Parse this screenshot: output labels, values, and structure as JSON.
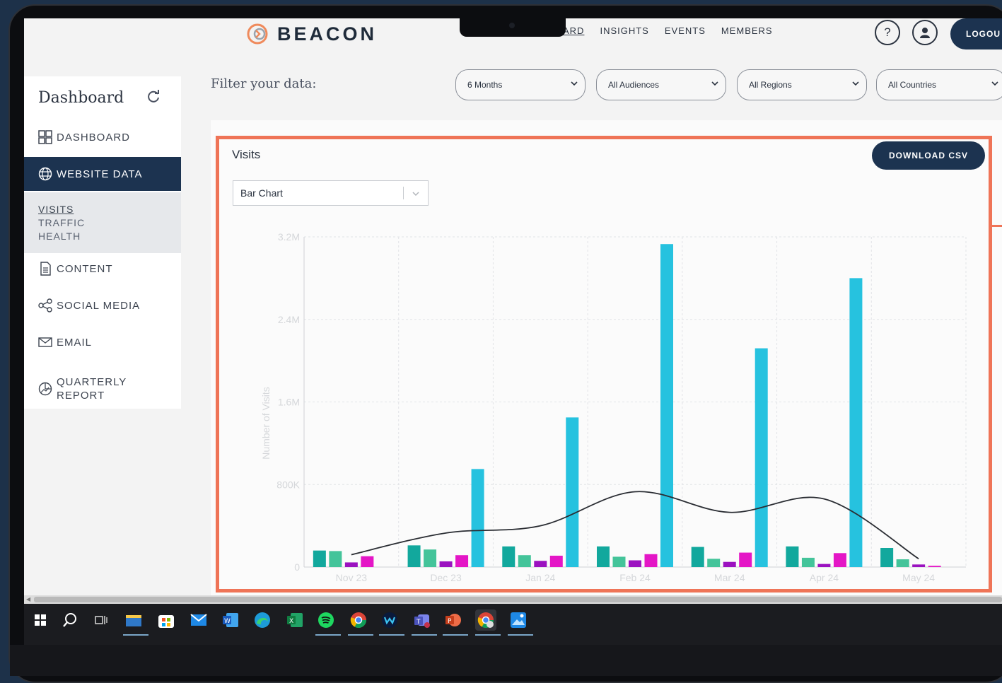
{
  "app": {
    "brand": "BEACON",
    "logout_label": "LOGOU"
  },
  "topnav": [
    {
      "label": "ARD",
      "active": true
    },
    {
      "label": "INSIGHTS"
    },
    {
      "label": "EVENTS"
    },
    {
      "label": "MEMBERS"
    }
  ],
  "header_icons": {
    "help": "?",
    "user": "user-icon"
  },
  "sidebar": {
    "title": "Dashboard",
    "items": [
      {
        "label": "DASHBOARD",
        "icon": "grid-icon"
      },
      {
        "label": "WEBSITE DATA",
        "icon": "globe-icon",
        "active": true
      },
      {
        "label": "CONTENT",
        "icon": "document-icon"
      },
      {
        "label": "SOCIAL MEDIA",
        "icon": "share-icon"
      },
      {
        "label": "EMAIL",
        "icon": "envelope-icon"
      },
      {
        "label": "QUARTERLY\nREPORT",
        "icon": "chart-globe-icon"
      }
    ],
    "subitems": [
      {
        "label": "VISITS",
        "active": true
      },
      {
        "label": "TRAFFIC"
      },
      {
        "label": "HEALTH"
      }
    ]
  },
  "filters": {
    "label": "Filter your data:",
    "period": "6 Months",
    "audience": "All Audiences",
    "region": "All Regions",
    "country": "All Countries"
  },
  "panel": {
    "title": "Visits",
    "download_label": "DOWNLOAD CSV",
    "chart_type_select": "Bar Chart"
  },
  "colors": {
    "navy": "#1c3350",
    "highlight": "#ef7457",
    "series": [
      "#12a89d",
      "#44c49a",
      "#9b12c0",
      "#e416c6",
      "#26c2df"
    ]
  },
  "chart_data": {
    "type": "bar",
    "ylabel": "Number of Visits",
    "ylim": [
      0,
      3200000
    ],
    "yticks": [
      {
        "value": 0,
        "label": "0"
      },
      {
        "value": 800000,
        "label": "800K"
      },
      {
        "value": 1600000,
        "label": "1.6M"
      },
      {
        "value": 2400000,
        "label": "2.4M"
      },
      {
        "value": 3200000,
        "label": "3.2M"
      }
    ],
    "categories": [
      "Nov 23",
      "Dec 23",
      "Jan 24",
      "Feb 24",
      "Mar 24",
      "Apr 24",
      "May 24"
    ],
    "series": [
      {
        "values": [
          160000,
          210000,
          200000,
          200000,
          195000,
          200000,
          185000
        ]
      },
      {
        "values": [
          155000,
          170000,
          115000,
          100000,
          80000,
          90000,
          75000
        ]
      },
      {
        "values": [
          45000,
          55000,
          60000,
          65000,
          50000,
          30000,
          25000
        ]
      },
      {
        "values": [
          105000,
          115000,
          110000,
          125000,
          140000,
          135000,
          12000
        ]
      },
      {
        "values": [
          0,
          950000,
          1450000,
          3130000,
          2120000,
          2800000,
          0
        ]
      }
    ],
    "trend_line": [
      120000,
      330000,
      400000,
      730000,
      530000,
      660000,
      80000
    ],
    "grid": true
  },
  "taskbar": {
    "icons": [
      "windows-start-icon",
      "search-icon",
      "task-view-icon",
      "file-explorer-icon",
      "store-icon",
      "mail-icon",
      "word-icon",
      "edge-icon",
      "excel-icon",
      "spotify-icon",
      "chrome-icon",
      "webex-icon",
      "teams-icon",
      "powerpoint-icon",
      "chrome-profile-icon",
      "photos-icon"
    ]
  }
}
